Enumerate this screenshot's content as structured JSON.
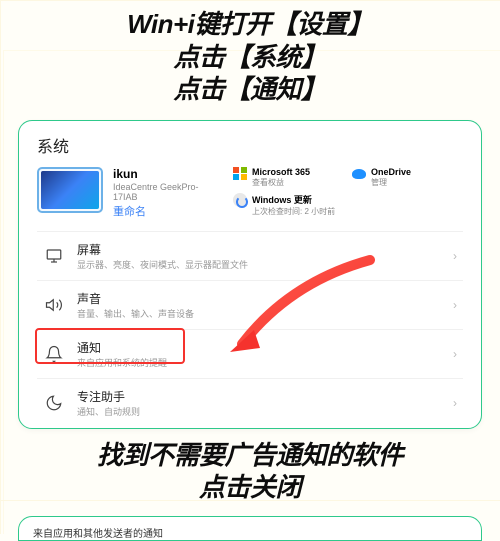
{
  "instructions_top": {
    "line1": "Win+i键打开【设置】",
    "line2": "点击【系统】",
    "line3": "点击【通知】"
  },
  "settings": {
    "title": "系统",
    "pc": {
      "name": "ikun",
      "model": "IdeaCentre GeekPro-17IAB",
      "rename": "重命名"
    },
    "tiles": {
      "ms365": {
        "title": "Microsoft 365",
        "sub": "查看权益"
      },
      "onedrive": {
        "title": "OneDrive",
        "sub": "管理"
      },
      "winupdate": {
        "title": "Windows 更新",
        "sub": "上次检查时间: 2 小时前"
      }
    },
    "rows": {
      "display": {
        "title": "屏幕",
        "sub": "显示器、亮度、夜间模式、显示器配置文件"
      },
      "sound": {
        "title": "声音",
        "sub": "音量、输出、输入、声音设备"
      },
      "notifications": {
        "title": "通知",
        "sub": "来自应用和系统的提醒"
      },
      "focus": {
        "title": "专注助手",
        "sub": "通知、自动规则"
      }
    }
  },
  "instructions_bottom": {
    "line1": "找到不需要广告通知的软件",
    "line2": "点击关闭"
  },
  "card2": {
    "text": "来自应用和其他发送者的通知"
  }
}
